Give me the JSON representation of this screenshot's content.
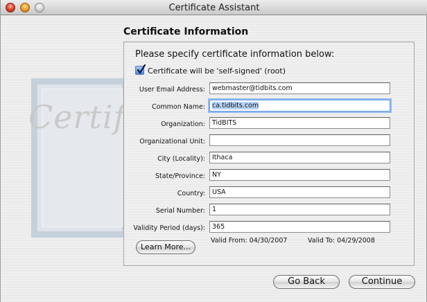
{
  "window": {
    "title": "Certificate Assistant"
  },
  "watermark": {
    "word": "Certificate"
  },
  "section_title": "Certificate Information",
  "prompt": "Please specify certificate information below:",
  "self_signed": {
    "label": "Certificate will be 'self-signed' (root)",
    "checked": true
  },
  "fields": {
    "email": {
      "label": "User Email Address:",
      "value": "webmaster@tidbits.com"
    },
    "common_name": {
      "label": "Common Name:",
      "value": "ca.tidbits.com"
    },
    "organization": {
      "label": "Organization:",
      "value": "TidBITS"
    },
    "org_unit": {
      "label": "Organizational Unit:",
      "value": ""
    },
    "city": {
      "label": "City (Locality):",
      "value": "Ithaca"
    },
    "state": {
      "label": "State/Province:",
      "value": "NY"
    },
    "country": {
      "label": "Country:",
      "value": "USA"
    },
    "serial": {
      "label": "Serial Number:",
      "value": "1"
    },
    "validity": {
      "label": "Validity Period (days):",
      "value": "365"
    }
  },
  "validity_dates": {
    "from": "Valid From: 04/30/2007",
    "to": "Valid To: 04/29/2008"
  },
  "buttons": {
    "learn_more": "Learn More...",
    "go_back": "Go Back",
    "continue": "Continue"
  },
  "colors": {
    "focus_ring": "#8fbaf0",
    "selection": "#b6d3f8",
    "checkbox": "#4a84d4"
  }
}
